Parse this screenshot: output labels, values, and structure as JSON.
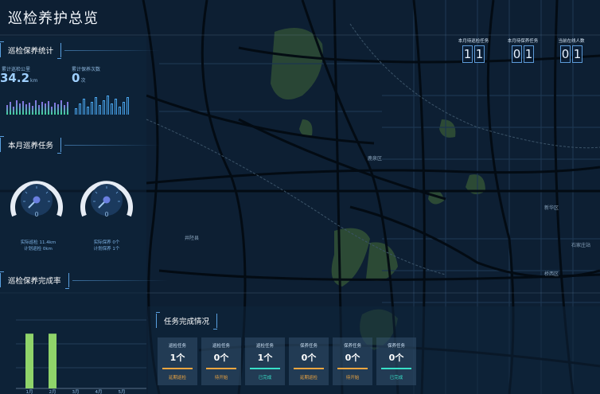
{
  "page_title": "巡检养护总览",
  "map": {
    "districts": [
      "井陉县",
      "鹿泉区",
      "新华区",
      "桥西区",
      "石家庄站"
    ]
  },
  "left": {
    "stats_section": "巡检保养统计",
    "inspect_label": "累计巡检公里",
    "inspect_value": "34.2",
    "inspect_unit": "km",
    "maint_label": "累计保养次数",
    "maint_value": "0",
    "maint_unit": "次",
    "monthly_section": "本月巡养任务",
    "gauge1_line1": "实际巡检 11.4km",
    "gauge1_line2": "计划巡检 0km",
    "gauge1_value": "0",
    "gauge2_line1": "实际保养 0个",
    "gauge2_line2": "计划保养 1个",
    "gauge2_value": "0",
    "rate_section": "巡检保养完成率",
    "rate_chart": {
      "categories": [
        "1月",
        "2月",
        "3月",
        "4月",
        "5月"
      ],
      "values": [
        0.8,
        0.8,
        0,
        0,
        0
      ]
    }
  },
  "counters": [
    {
      "label": "本月待巡检任务",
      "d1": "1",
      "d2": "1"
    },
    {
      "label": "本月待保养任务",
      "d1": "0",
      "d2": "1"
    },
    {
      "label": "当前在线人数",
      "d1": "0",
      "d2": "1"
    }
  ],
  "tasks": {
    "section": "任务完成情况",
    "cards": [
      {
        "label": "巡检任务",
        "value": "1个",
        "status": "延期巡检",
        "color": "#f0a640"
      },
      {
        "label": "巡检任务",
        "value": "0个",
        "status": "待开始",
        "color": "#f0a640"
      },
      {
        "label": "巡检任务",
        "value": "1个",
        "status": "已完成",
        "color": "#38e0c8"
      },
      {
        "label": "保养任务",
        "value": "0个",
        "status": "延期巡检",
        "color": "#f0a640"
      },
      {
        "label": "保养任务",
        "value": "0个",
        "status": "待开始",
        "color": "#f0a640"
      },
      {
        "label": "保养任务",
        "value": "0个",
        "status": "已完成",
        "color": "#38e0c8"
      }
    ]
  }
}
